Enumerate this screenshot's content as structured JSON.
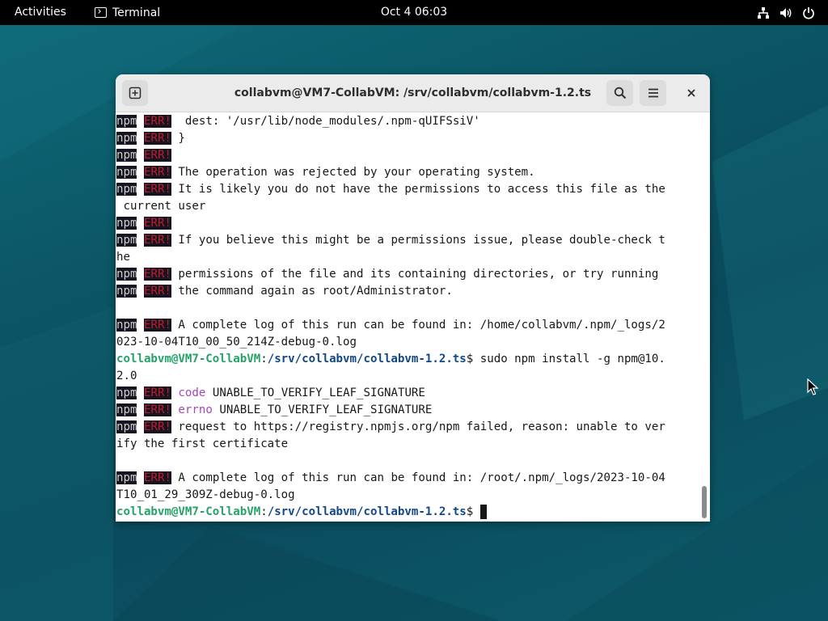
{
  "topbar": {
    "activities": "Activities",
    "app_name": "Terminal",
    "clock": "Oct 4  06:03",
    "tray_icons": [
      "network-icon",
      "volume-icon",
      "power-icon"
    ]
  },
  "window": {
    "title": "collabvm@VM7-CollabVM: /srv/collabvm/collabvm-1.2.ts",
    "new_tab_icon": "new-tab-icon",
    "search_icon": "search-icon",
    "menu_icon": "hamburger-menu-icon",
    "close_icon": "close-icon"
  },
  "terminal": {
    "npm": "npm",
    "err": "ERR!",
    "prompt_user": "collabvm@VM7-CollabVM",
    "prompt_path": "/srv/collabvm/collabvm-1.2.ts",
    "lines": {
      "l01": "  dest: '/usr/lib/node_modules/.npm-qUIFSsiV'",
      "l02": " }",
      "l04": " The operation was rejected by your operating system.",
      "l05": " It is likely you do not have the permissions to access this file as the",
      "l06": " current user",
      "l08": " If you believe this might be a permissions issue, please double-check t",
      "l09": "he",
      "l10": " permissions of the file and its containing directories, or try running",
      "l11": " the command again as root/Administrator.",
      "l13": " A complete log of this run can be found in: /home/collabvm/.npm/_logs/2",
      "l14": "023-10-04T10_00_50_214Z-debug-0.log",
      "l15_cmd": "$ sudo npm install -g npm@10.",
      "l16": "2.0",
      "l17_key": "code",
      "l17_val": " UNABLE_TO_VERIFY_LEAF_SIGNATURE",
      "l18_key": "errno",
      "l18_val": " UNABLE_TO_VERIFY_LEAF_SIGNATURE",
      "l19": " request to https://registry.npmjs.org/npm failed, reason: unable to ver",
      "l20": "ify the first certificate",
      "l22": " A complete log of this run can be found in: /root/.npm/_logs/2023-10-04",
      "l23": "T10_01_29_309Z-debug-0.log",
      "l24_cmd": "$ "
    }
  }
}
